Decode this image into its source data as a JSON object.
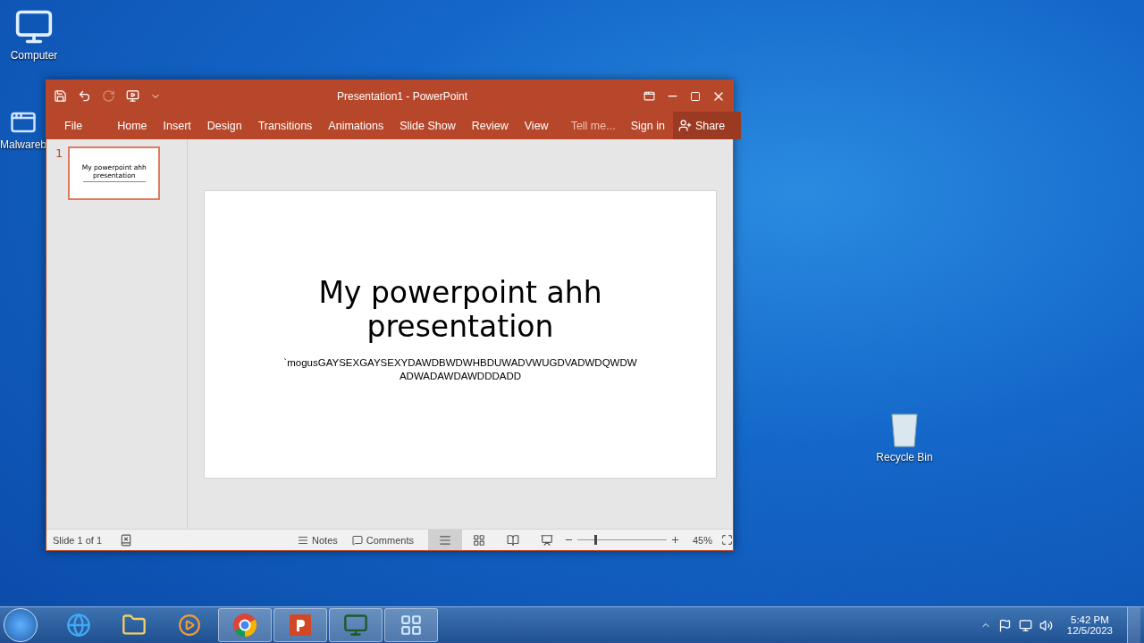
{
  "desktop_icons": [
    {
      "label": "Computer",
      "kind": "computer"
    },
    {
      "label": "Malwareb",
      "kind": "shortcut"
    },
    {
      "label": "Recycle Bin",
      "kind": "recycle"
    }
  ],
  "window": {
    "title": "Presentation1 - PowerPoint",
    "menu": [
      {
        "label": "File"
      },
      {
        "label": "Home"
      },
      {
        "label": "Insert"
      },
      {
        "label": "Design"
      },
      {
        "label": "Transitions"
      },
      {
        "label": "Animations"
      },
      {
        "label": "Slide Show"
      },
      {
        "label": "Review"
      },
      {
        "label": "View"
      }
    ],
    "tell_me": "Tell me...",
    "sign_in": "Sign in",
    "share": "Share"
  },
  "thumbnails": [
    {
      "number": "1",
      "title": "My powerpoint ahh presentation",
      "selected": true
    }
  ],
  "slide": {
    "title": "My powerpoint ahh presentation",
    "subtitle": "`mogusGAYSEXGAYSEXYDAWDBWDWHBDUWADVWUGDVADWDQWDW ADWADAWDAWDDDADD"
  },
  "status_bar": {
    "slide_info": "Slide 1 of 1",
    "notes": "Notes",
    "comments": "Comments",
    "views": [
      {
        "kind": "normal",
        "selected": true
      },
      {
        "kind": "sorter",
        "selected": false
      },
      {
        "kind": "reading",
        "selected": false
      },
      {
        "kind": "slideshow",
        "selected": false
      }
    ],
    "zoom": {
      "level": 0.2,
      "reading": "45%"
    }
  },
  "taskbar": {
    "apps": [
      {
        "kind": "ie",
        "running": false
      },
      {
        "kind": "explorer",
        "running": false
      },
      {
        "kind": "media",
        "running": false
      },
      {
        "kind": "chrome",
        "running": true
      },
      {
        "kind": "powerpoint",
        "running": true
      },
      {
        "kind": "monitor",
        "running": true
      },
      {
        "kind": "control",
        "running": true
      }
    ],
    "time": "5:42 PM",
    "date": "12/5/2023"
  }
}
